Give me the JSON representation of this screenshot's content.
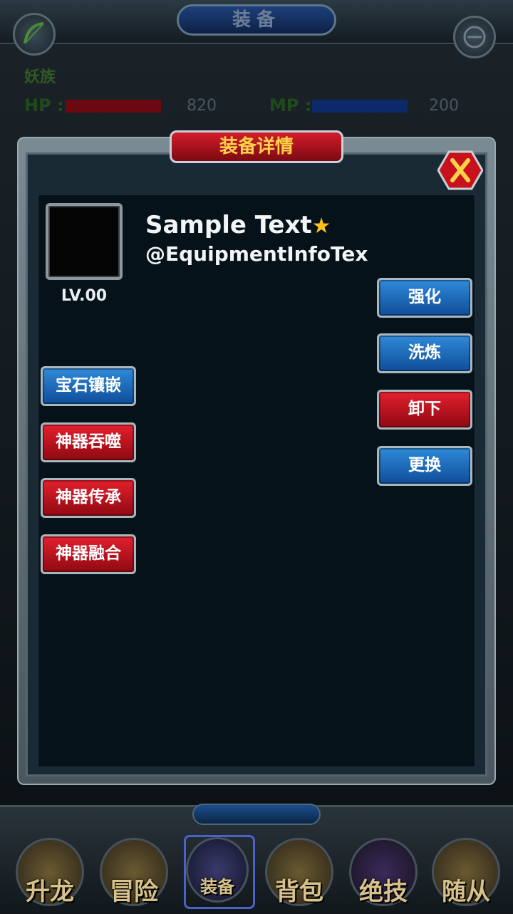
{
  "screen": {
    "title": "装备"
  },
  "player": {
    "race": "妖族",
    "hp_label": "HP :",
    "hp_value": "820",
    "mp_label": "MP :",
    "mp_value": "200"
  },
  "dialog": {
    "title": "装备详情",
    "item": {
      "name": "Sample Text",
      "star": "★",
      "description": "@EquipmentInfoTex",
      "level": "LV.00"
    },
    "right_buttons": [
      {
        "label": "强化",
        "color": "#1a65b8"
      },
      {
        "label": "洗炼",
        "color": "#1a65b8"
      },
      {
        "label": "卸下",
        "color": "#b5141f"
      },
      {
        "label": "更换",
        "color": "#1a65b8"
      }
    ],
    "left_buttons": [
      {
        "label": "宝石镶嵌",
        "color": "#1a65b8"
      },
      {
        "label": "神器吞噬",
        "color": "#b5141f"
      },
      {
        "label": "神器传承",
        "color": "#b5141f"
      },
      {
        "label": "神器融合",
        "color": "#b5141f"
      }
    ]
  },
  "nav": {
    "items": [
      {
        "label": "升龙"
      },
      {
        "label": "冒险"
      },
      {
        "label": "装备"
      },
      {
        "label": "背包"
      },
      {
        "label": "绝技"
      },
      {
        "label": "随从"
      }
    ],
    "selected_index": 2
  },
  "colors": {
    "accent_red": "#b5141f",
    "accent_blue": "#1a65b8",
    "title_gold": "#ffd24a"
  }
}
